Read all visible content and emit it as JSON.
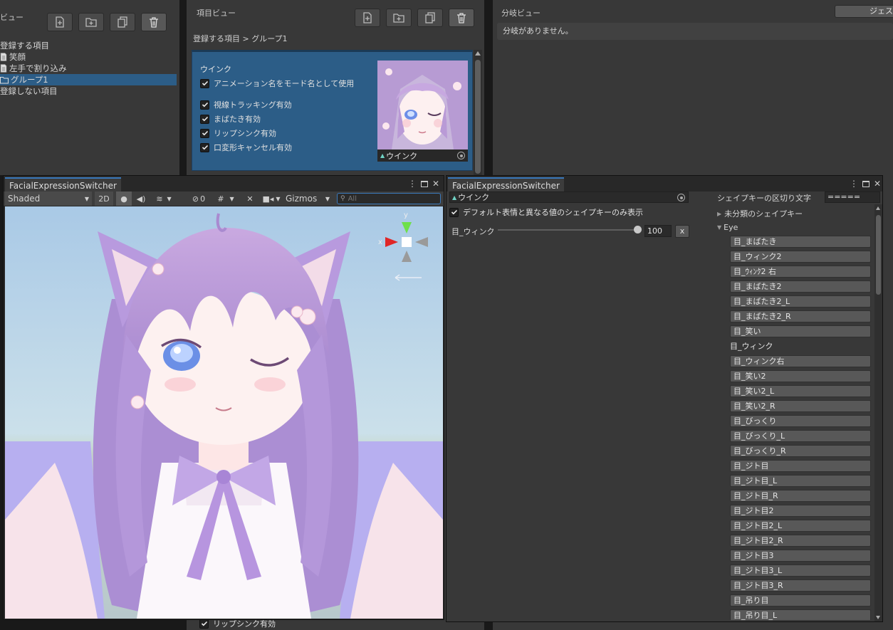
{
  "hierarchy": {
    "title": "ビュー",
    "items": [
      {
        "label": "登録する項目",
        "icon": "none"
      },
      {
        "label": "笑顔",
        "icon": "document-icon"
      },
      {
        "label": "左手で割り込み",
        "icon": "document-icon"
      },
      {
        "label": "グループ1",
        "icon": "folder-icon",
        "selected": true
      },
      {
        "label": "登録しない項目",
        "icon": "none"
      }
    ]
  },
  "item_view": {
    "title": "項目ビュー",
    "breadcrumb": "登録する項目 > グループ1",
    "item_name": "ウインク",
    "use_anim_name": "アニメーション名をモード名として使用",
    "checks": [
      "視線トラッキング有効",
      "まばたき有効",
      "リップシンク有効",
      "口変形キャンセル有効"
    ],
    "thumbnail_label": "ウインク",
    "bottom_check": "リップシンク有効"
  },
  "branch_view": {
    "title": "分岐ビュー",
    "gesture_button": "ジェスチ",
    "empty_message": "分岐がありません。"
  },
  "scene_window": {
    "tab": "FacialExpressionSwitcher",
    "shading_mode": "Shaded",
    "mode_2d": "2D",
    "hidden_count": "0",
    "gizmos": "Gizmos",
    "search_placeholder": "All",
    "gizmo_x": "x",
    "gizmo_y": "y"
  },
  "expression_window": {
    "tab": "FacialExpressionSwitcher",
    "clip_name": "ウインク",
    "only_diff_label": "デフォルト表情と異なる値のシェイプキーのみ表示",
    "slider_label": "目_ウィンク",
    "slider_value": "100",
    "slider_fraction": 1.0,
    "remove_button": "x",
    "delimiter_label": "シェイプキーの区切り文字",
    "delimiter_value": "=====",
    "uncategorized": "未分類のシェイプキー",
    "group_eye": "Eye",
    "shape_keys": [
      {
        "label": "目_まばたき",
        "active": false
      },
      {
        "label": "目_ウィンク2",
        "active": false
      },
      {
        "label": "目_ｳｨﾝｸ2 右",
        "active": false
      },
      {
        "label": "目_まばたき2",
        "active": false
      },
      {
        "label": "目_まばたき2_L",
        "active": false
      },
      {
        "label": "目_まばたき2_R",
        "active": false
      },
      {
        "label": "目_笑い",
        "active": false
      },
      {
        "label": "目_ウィンク",
        "active": true
      },
      {
        "label": "目_ウィンク右",
        "active": false
      },
      {
        "label": "目_笑い2",
        "active": false
      },
      {
        "label": "目_笑い2_L",
        "active": false
      },
      {
        "label": "目_笑い2_R",
        "active": false
      },
      {
        "label": "目_びっくり",
        "active": false
      },
      {
        "label": "目_びっくり_L",
        "active": false
      },
      {
        "label": "目_びっくり_R",
        "active": false
      },
      {
        "label": "目_ジト目",
        "active": false
      },
      {
        "label": "目_ジト目_L",
        "active": false
      },
      {
        "label": "目_ジト目_R",
        "active": false
      },
      {
        "label": "目_ジト目2",
        "active": false
      },
      {
        "label": "目_ジト目2_L",
        "active": false
      },
      {
        "label": "目_ジト目2_R",
        "active": false
      },
      {
        "label": "目_ジト目3",
        "active": false
      },
      {
        "label": "目_ジト目3_L",
        "active": false
      },
      {
        "label": "目_ジト目3_R",
        "active": false
      },
      {
        "label": "目_吊り目",
        "active": false
      },
      {
        "label": "目_吊り目_L",
        "active": false
      }
    ]
  },
  "colors": {
    "selection": "#2c5d87",
    "accent_tab": "#3a79bb",
    "panel": "#383838",
    "sky_top": "#a9c9e6"
  }
}
